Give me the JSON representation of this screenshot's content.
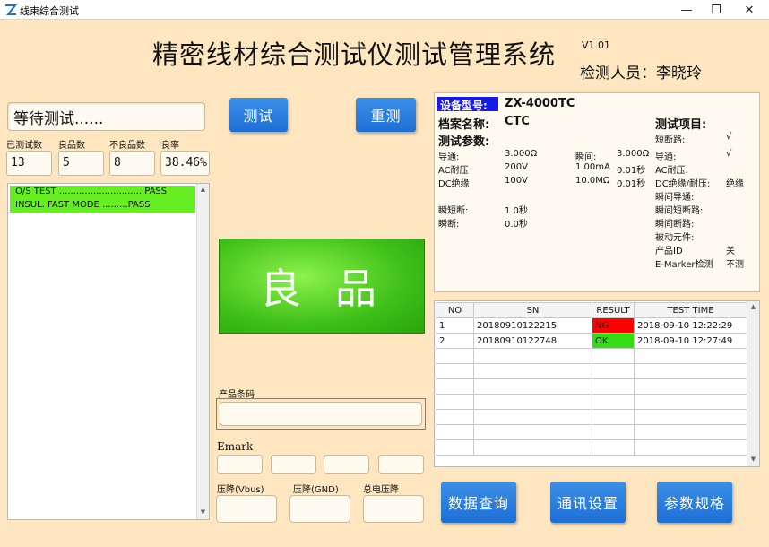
{
  "window": {
    "title": "线束综合测试",
    "minimize": "—",
    "restore": "❐",
    "close": "✕"
  },
  "header": {
    "title": "精密线材综合测试仪测试管理系统",
    "version": "V1.01",
    "inspector": "检测人员：李晓玲"
  },
  "status": {
    "text": "等待测试......"
  },
  "stats": {
    "tested_label": "已测试数",
    "tested_value": "13",
    "good_label": "良品数",
    "good_value": "5",
    "bad_label": "不良品数",
    "bad_value": "8",
    "rate_label": "良率",
    "rate_value": "38.46%"
  },
  "log": {
    "lines": [
      "O/S  TEST ..............................PASS",
      "INSUL. FAST MODE .........PASS"
    ]
  },
  "buttons": {
    "test": "测试",
    "retest": "重测",
    "data_query": "数据查询",
    "comm_settings": "通讯设置",
    "param_spec": "参数规格"
  },
  "result": {
    "text": "良品",
    "color": "#3fc018"
  },
  "product": {
    "barcode_label": "产品条码",
    "barcode_value": "",
    "emark_label": "Emark",
    "vbus_drop_label": "压降(Vbus)",
    "gnd_drop_label": "压降(GND)",
    "total_drop_label": "总电压降"
  },
  "info": {
    "model_label": "设备型号:",
    "model_value": "ZX-4000TC",
    "file_label": "档案名称:",
    "file_value": "CTC",
    "params_label": "测试参数:",
    "items_label": "测试项目:",
    "params": [
      {
        "name": "导通:",
        "v1": "3.000Ω",
        "v2": "瞬间:",
        "v3": "3.000Ω"
      },
      {
        "name": "AC耐压",
        "v1": "200V",
        "v2": "1.00mA",
        "v3": "0.01秒"
      },
      {
        "name": "DC绝缘",
        "v1": "100V",
        "v2": "10.0MΩ",
        "v3": "0.01秒"
      },
      {
        "name": "瞬短断:",
        "v1": "1.0秒",
        "v2": "",
        "v3": ""
      },
      {
        "name": "瞬断:",
        "v1": "0.0秒",
        "v2": "",
        "v3": ""
      }
    ],
    "items": [
      {
        "name": "短断路:",
        "value": "√"
      },
      {
        "name": "导通:",
        "value": "√"
      },
      {
        "name": "AC耐压:",
        "value": ""
      },
      {
        "name": "DC绝缘/耐压:",
        "value": "绝缘"
      },
      {
        "name": "瞬间导通:",
        "value": ""
      },
      {
        "name": "瞬间短断路:",
        "value": ""
      },
      {
        "name": "瞬间断路:",
        "value": ""
      },
      {
        "name": "被动元件:",
        "value": ""
      },
      {
        "name": "产品ID",
        "value": "关"
      },
      {
        "name": "E-Marker检测",
        "value": "不测"
      }
    ]
  },
  "records": {
    "columns": [
      "NO",
      "SN",
      "RESULT",
      "TEST TIME"
    ],
    "rows": [
      {
        "no": "1",
        "sn": "20180910122215",
        "result": "NG",
        "time": "2018-09-10 12:22:29"
      },
      {
        "no": "2",
        "sn": "20180910122748",
        "result": "OK",
        "time": "2018-09-10 12:27:49"
      }
    ],
    "ng_color": "#ff0000",
    "ok_color": "#33dd11"
  }
}
